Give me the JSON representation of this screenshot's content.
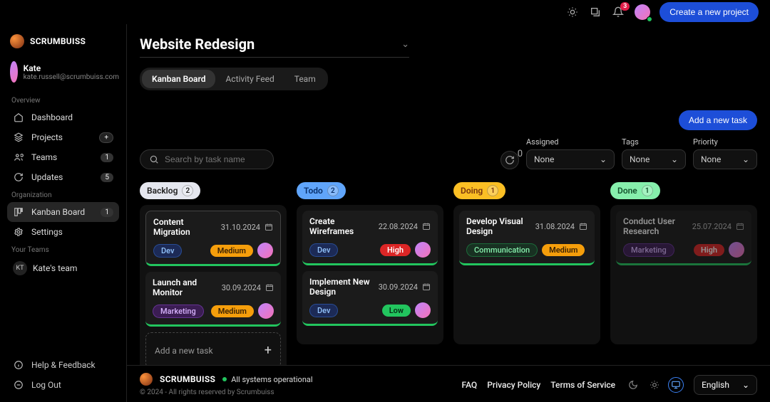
{
  "topbar": {
    "notification_count": "3",
    "refresh_count": "0",
    "create_project_label": "Create a new project"
  },
  "brand": {
    "name": "SCRUMBUISS"
  },
  "user": {
    "name": "Kate",
    "email": "kate.russell@scrumbuiss.com"
  },
  "sidebar": {
    "section_overview": "Overview",
    "section_org": "Organization",
    "section_teams": "Your Teams",
    "items": {
      "dashboard": "Dashboard",
      "projects": "Projects",
      "teams": "Teams",
      "teams_count": "1",
      "updates": "Updates",
      "updates_count": "5",
      "kanban": "Kanban Board",
      "kanban_count": "1",
      "settings": "Settings"
    },
    "team": {
      "initials": "KT",
      "name": "Kate's team"
    },
    "footer": {
      "help": "Help & Feedback",
      "logout": "Log Out"
    }
  },
  "project": {
    "title": "Website Redesign"
  },
  "tabs": {
    "kanban": "Kanban Board",
    "activity": "Activity Feed",
    "team": "Team"
  },
  "toolbar": {
    "add_task": "Add a new task",
    "search_placeholder": "Search by task name",
    "refresh_count": "0",
    "filters": {
      "assigned": {
        "label": "Assigned",
        "value": "None"
      },
      "tags": {
        "label": "Tags",
        "value": "None"
      },
      "priority": {
        "label": "Priority",
        "value": "None"
      }
    }
  },
  "columns": {
    "backlog": {
      "label": "Backlog",
      "count": "2"
    },
    "todo": {
      "label": "Todo",
      "count": "2"
    },
    "doing": {
      "label": "Doing",
      "count": "1"
    },
    "done": {
      "label": "Done",
      "count": "1"
    }
  },
  "cards": {
    "backlog": [
      {
        "title": "Content Migration",
        "date": "31.10.2024",
        "tag": "Dev",
        "tag_class": "tag-dev",
        "priority": "Medium",
        "prio_class": "prio-medium"
      },
      {
        "title": "Launch and Monitor",
        "date": "30.09.2024",
        "tag": "Marketing",
        "tag_class": "tag-marketing",
        "priority": "Medium",
        "prio_class": "prio-medium"
      }
    ],
    "todo": [
      {
        "title": "Create Wireframes",
        "date": "22.08.2024",
        "tag": "Dev",
        "tag_class": "tag-dev",
        "priority": "High",
        "prio_class": "prio-high"
      },
      {
        "title": "Implement New Design",
        "date": "30.09.2024",
        "tag": "Dev",
        "tag_class": "tag-dev",
        "priority": "Low",
        "prio_class": "prio-low"
      }
    ],
    "doing": [
      {
        "title": "Develop Visual Design",
        "date": "31.08.2024",
        "tag": "Communication",
        "tag_class": "tag-comm",
        "priority": "Medium",
        "prio_class": "prio-medium"
      }
    ],
    "done": [
      {
        "title": "Conduct User Research",
        "date": "25.07.2024",
        "tag": "Marketing",
        "tag_class": "tag-marketing",
        "priority": "High",
        "prio_class": "prio-high"
      }
    ]
  },
  "add_task_inline": "Add a new task",
  "footer": {
    "brand": "SCRUMBUISS",
    "status": "All systems operational",
    "copyright": "© 2024 - All rights reserved by Scrumbuiss",
    "links": {
      "faq": "FAQ",
      "privacy": "Privacy Policy",
      "terms": "Terms of Service"
    },
    "language": "English"
  }
}
